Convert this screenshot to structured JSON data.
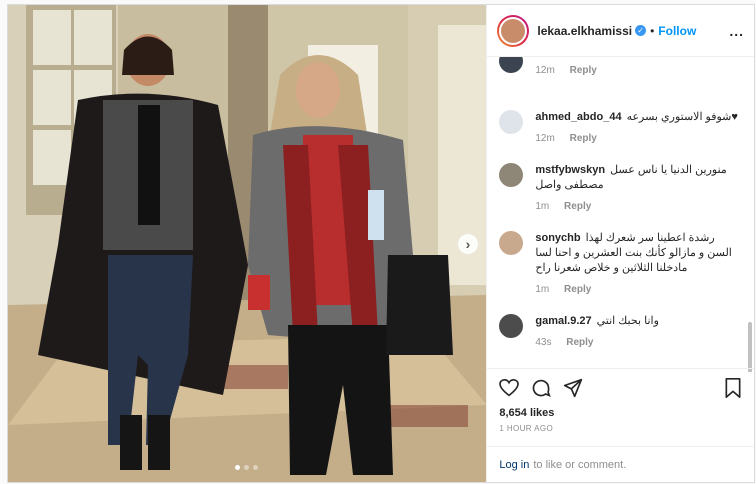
{
  "header": {
    "username": "lekaa.elkhamissi",
    "verified_mark": "✓",
    "separator": "•",
    "follow_label": "Follow",
    "more_label": "..."
  },
  "carousel": {
    "total_slides": 3,
    "active_slide": 1,
    "next_icon": "chevron-right-icon"
  },
  "comments": [
    {
      "user": "",
      "text": "",
      "time": "12m",
      "reply": "Reply"
    },
    {
      "user": "ahmed_abdo_44",
      "text": "شوفو الاستوري بسرعه♥",
      "time": "12m",
      "reply": "Reply"
    },
    {
      "user": "mstfybwskyn",
      "text": "منورين الدنيا يا ناس عسل مصطفى واصل",
      "time": "1m",
      "reply": "Reply"
    },
    {
      "user": "sonychb",
      "text": "رشدة اعطينا سر شعرك لهذا السن و مازالو كأنك بنت العشرين و احنا لسا مادخلنا الثلاثين و خلاص شعرنا راح",
      "time": "1m",
      "reply": "Reply"
    },
    {
      "user": "gamal.9.27",
      "text": "وانا بحبك انتي",
      "time": "43s",
      "reply": "Reply"
    }
  ],
  "actions": {
    "like_icon": "heart-icon",
    "comment_icon": "comment-icon",
    "share_icon": "share-icon",
    "save_icon": "bookmark-icon",
    "likes_text": "8,654 likes",
    "time_ago": "1 HOUR AGO"
  },
  "login": {
    "link_label": "Log in",
    "suffix": "to like or comment."
  }
}
